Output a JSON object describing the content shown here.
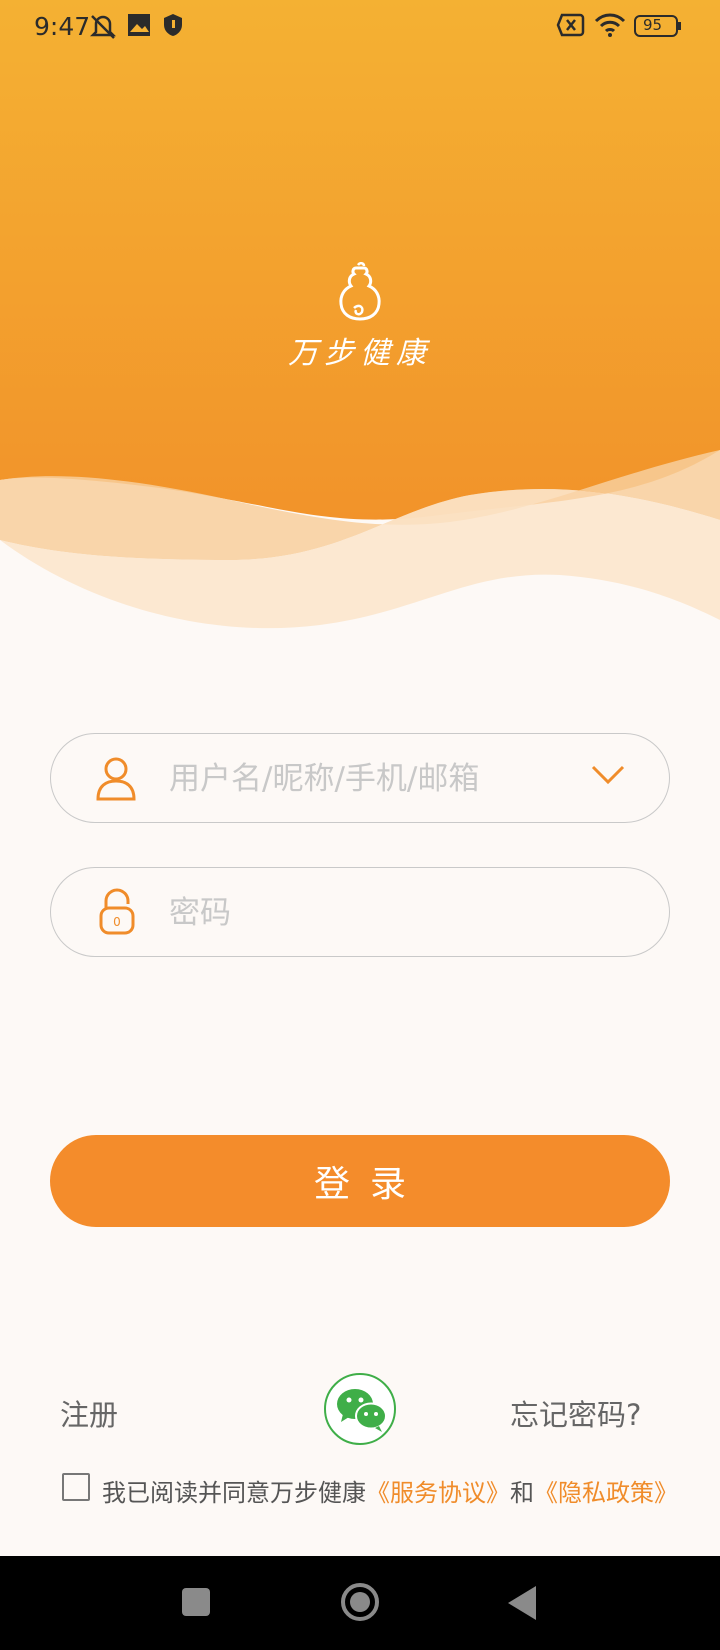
{
  "status_bar": {
    "time": "9:47",
    "battery": "95",
    "icons": [
      "mute-bell-icon",
      "image-icon",
      "shield-icon",
      "sim-off-icon",
      "wifi-icon",
      "battery-icon"
    ]
  },
  "brand": {
    "app_name": "万步健康",
    "logo_icon": "gourd-logo-icon"
  },
  "form": {
    "username_placeholder": "用户名/昵称/手机/邮箱",
    "password_placeholder": "密码",
    "username_icon": "user-icon",
    "password_icon": "lock-icon",
    "dropdown_icon": "chevron-down-icon"
  },
  "actions": {
    "login_label": "登录",
    "register_label": "注册",
    "forgot_label": "忘记密码?",
    "wechat_icon": "wechat-icon"
  },
  "agreement": {
    "prefix": "我已阅读并同意万步健康",
    "service_link": "《服务协议》",
    "conjunction": "和",
    "privacy_link": "《隐私政策》",
    "checked": false
  },
  "colors": {
    "accent": "#f48c2b",
    "header_top": "#f4b133",
    "header_bottom": "#f2932a",
    "wechat": "#3fae48",
    "link": "#f08c2a"
  }
}
